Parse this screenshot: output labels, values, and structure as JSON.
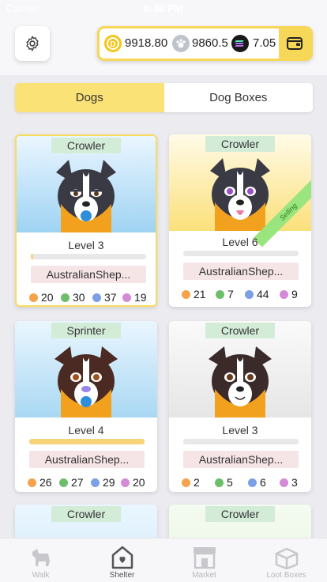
{
  "status_bar": {
    "carrier": "Carrier",
    "time": "8:38 PM"
  },
  "wallet": {
    "balances": [
      {
        "icon": "gold-coin-icon",
        "value": "9918.80",
        "color": "#f5c518"
      },
      {
        "icon": "paw-coin-icon",
        "value": "9860.5",
        "color": "#bfc4cc"
      },
      {
        "icon": "solana-coin-icon",
        "value": "7.05",
        "color": "#1a1a1a"
      }
    ]
  },
  "tabs": [
    {
      "label": "Dogs",
      "active": true
    },
    {
      "label": "Dog Boxes",
      "active": false
    }
  ],
  "dogs": [
    {
      "type": "Crowler",
      "level": "Level 3",
      "xp": 0.02,
      "breed": "AustralianShep...",
      "bg": "blue",
      "stats": [
        "20",
        "30",
        "37",
        "19"
      ],
      "selling": false,
      "selected": true
    },
    {
      "type": "Crowler",
      "level": "Level 6",
      "xp": 0,
      "breed": "AustralianShep...",
      "bg": "yellow",
      "stats": [
        "21",
        "7",
        "44",
        "9"
      ],
      "selling": true,
      "selling_label": "Selling",
      "selected": false
    },
    {
      "type": "Sprinter",
      "level": "Level 4",
      "xp": 1.0,
      "breed": "AustralianShep...",
      "bg": "blue",
      "stats": [
        "26",
        "27",
        "29",
        "20"
      ],
      "selling": false,
      "selected": false
    },
    {
      "type": "Crowler",
      "level": "Level 3",
      "xp": 0,
      "breed": "AustralianShep...",
      "bg": "grey",
      "stats": [
        "2",
        "5",
        "6",
        "3"
      ],
      "selling": false,
      "selected": false
    },
    {
      "type": "Crowler",
      "bg": "blue"
    },
    {
      "type": "Crowler",
      "bg": "green"
    }
  ],
  "stat_colors": [
    "#f5a24a",
    "#6dbf6a",
    "#7ca0e6",
    "#d58ad8"
  ],
  "tabbar": [
    {
      "label": "Walk",
      "icon": "dog-walk-icon",
      "active": false
    },
    {
      "label": "Shelter",
      "icon": "shelter-house-icon",
      "active": true
    },
    {
      "label": "Market",
      "icon": "market-stall-icon",
      "active": false
    },
    {
      "label": "Loot Boxes",
      "icon": "loot-box-icon",
      "active": false
    }
  ]
}
